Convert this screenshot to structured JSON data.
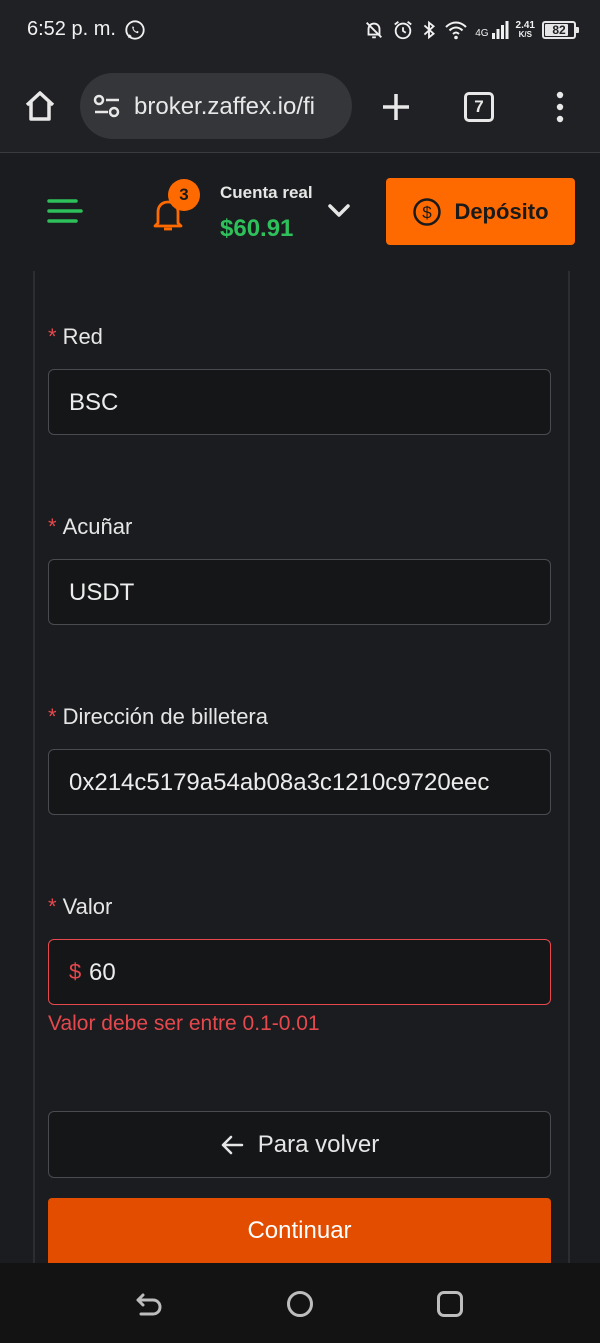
{
  "status_bar": {
    "time": "6:52 p. m.",
    "network": "4G",
    "speed_value": "2.41",
    "speed_unit": "K/S",
    "battery": "82",
    "battery_level": 0.82,
    "icons": [
      "whatsapp-icon",
      "bell-off-icon",
      "alarm-icon",
      "bluetooth-icon",
      "wifi-icon",
      "signal-icon",
      "battery-icon"
    ]
  },
  "browser": {
    "url": "broker.zaffex.io/fi",
    "tab_count": "7"
  },
  "header": {
    "notification_count": "3",
    "account_type": "Cuenta real",
    "balance": "$60.91",
    "deposit_label": "Depósito"
  },
  "form": {
    "required_mark": "*",
    "network": {
      "label": "Red",
      "value": "BSC"
    },
    "coin": {
      "label": "Acuñar",
      "value": "USDT"
    },
    "wallet": {
      "label": "Dirección de billetera",
      "value": "0x214c5179a54ab08a3c1210c9720eec"
    },
    "amount": {
      "label": "Valor",
      "prefix": "$",
      "value": "60",
      "error": "Valor debe ser entre 0.1-0.01"
    },
    "back_label": "Para volver",
    "continue_label": "Continuar"
  },
  "colors": {
    "accent": "#ff6a00",
    "continue": "#e24d00",
    "balance": "#2ec05a",
    "error": "#e5484d",
    "background": "#1b1c1f"
  }
}
